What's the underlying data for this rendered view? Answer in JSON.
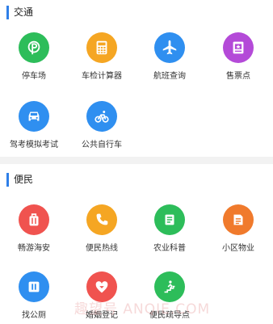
{
  "sections": [
    {
      "title": "交通",
      "items": [
        {
          "label": "停车场",
          "icon": "parking-icon",
          "color": "#2dbd5a"
        },
        {
          "label": "车检计算器",
          "icon": "calculator-icon",
          "color": "#f5a623"
        },
        {
          "label": "航班查询",
          "icon": "airplane-icon",
          "color": "#2f8ff0"
        },
        {
          "label": "售票点",
          "icon": "ticket-icon",
          "color": "#b44ad8"
        },
        {
          "label": "驾考模拟考试",
          "icon": "car-icon",
          "color": "#2f8ff0"
        },
        {
          "label": "公共自行车",
          "icon": "bicycle-icon",
          "color": "#2f8ff0"
        }
      ]
    },
    {
      "title": "便民",
      "items": [
        {
          "label": "畅游海安",
          "icon": "luggage-icon",
          "color": "#f0534f"
        },
        {
          "label": "便民热线",
          "icon": "phone-icon",
          "color": "#f5a623"
        },
        {
          "label": "农业科普",
          "icon": "document-icon",
          "color": "#2dbd5a"
        },
        {
          "label": "小区物业",
          "icon": "property-doc-icon",
          "color": "#f07a2c"
        },
        {
          "label": "找公厕",
          "icon": "toilet-icon",
          "color": "#2f8ff0"
        },
        {
          "label": "婚姻登记",
          "icon": "heart-icon",
          "color": "#f0534f"
        },
        {
          "label": "便民疏导点",
          "icon": "guide-stairs-icon",
          "color": "#2dbd5a"
        }
      ]
    }
  ],
  "watermark": "趣望号 ANQIE.COM"
}
